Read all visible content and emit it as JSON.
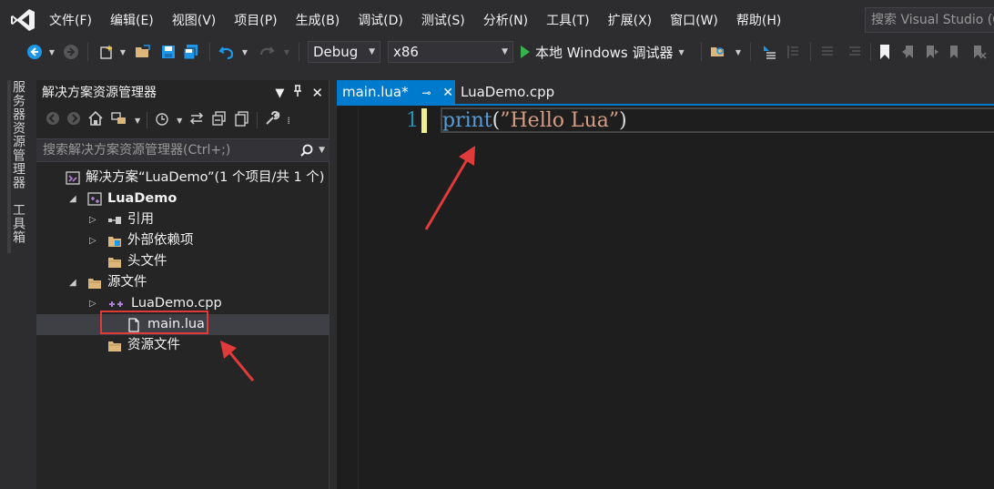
{
  "menu": {
    "items": [
      "文件(F)",
      "编辑(E)",
      "视图(V)",
      "项目(P)",
      "生成(B)",
      "调试(D)",
      "测试(S)",
      "分析(N)",
      "工具(T)",
      "扩展(X)",
      "窗口(W)",
      "帮助(H)"
    ],
    "quick_launch_placeholder": "搜索 Visual Studio (Ctrl+Q)"
  },
  "toolbar": {
    "configuration": "Debug",
    "platform": "x86",
    "run_label": "本地 Windows 调试器"
  },
  "left_strip": {
    "tabs": [
      "服务器资源管理器",
      "工具箱"
    ]
  },
  "solution_explorer": {
    "title": "解决方案资源管理器",
    "search_placeholder": "搜索解决方案资源管理器(Ctrl+;)",
    "tree": [
      {
        "label": "解决方案“LuaDemo”(1 个项目/共 1 个)",
        "icon": "solution-icon",
        "expander": "",
        "selected": false
      },
      {
        "label": "LuaDemo",
        "icon": "project-icon",
        "expander": "expanded",
        "selected": false
      },
      {
        "label": "引用",
        "icon": "references-icon",
        "expander": "collapsed",
        "selected": false
      },
      {
        "label": "外部依赖项",
        "icon": "external-deps-icon",
        "expander": "collapsed",
        "selected": false
      },
      {
        "label": "头文件",
        "icon": "folder-icon",
        "expander": "",
        "selected": false
      },
      {
        "label": "源文件",
        "icon": "folder-icon",
        "expander": "expanded",
        "selected": false
      },
      {
        "label": "LuaDemo.cpp",
        "icon": "cpp-file-icon",
        "expander": "collapsed",
        "selected": false
      },
      {
        "label": "main.lua",
        "icon": "file-icon",
        "expander": "",
        "selected": true
      },
      {
        "label": "资源文件",
        "icon": "folder-icon",
        "expander": "",
        "selected": false
      }
    ]
  },
  "editor": {
    "tabs": [
      {
        "label": "main.lua*",
        "active": true
      },
      {
        "label": "LuaDemo.cpp",
        "active": false
      }
    ],
    "line_number": "1",
    "code": {
      "keyword": "print",
      "open": "(",
      "string": "”Hello Lua”",
      "close": ")"
    }
  },
  "colors": {
    "accent": "#007acc",
    "background": "#2d2d30",
    "editor_bg": "#1e1e1e",
    "annotation_red": "#e03a3a"
  }
}
